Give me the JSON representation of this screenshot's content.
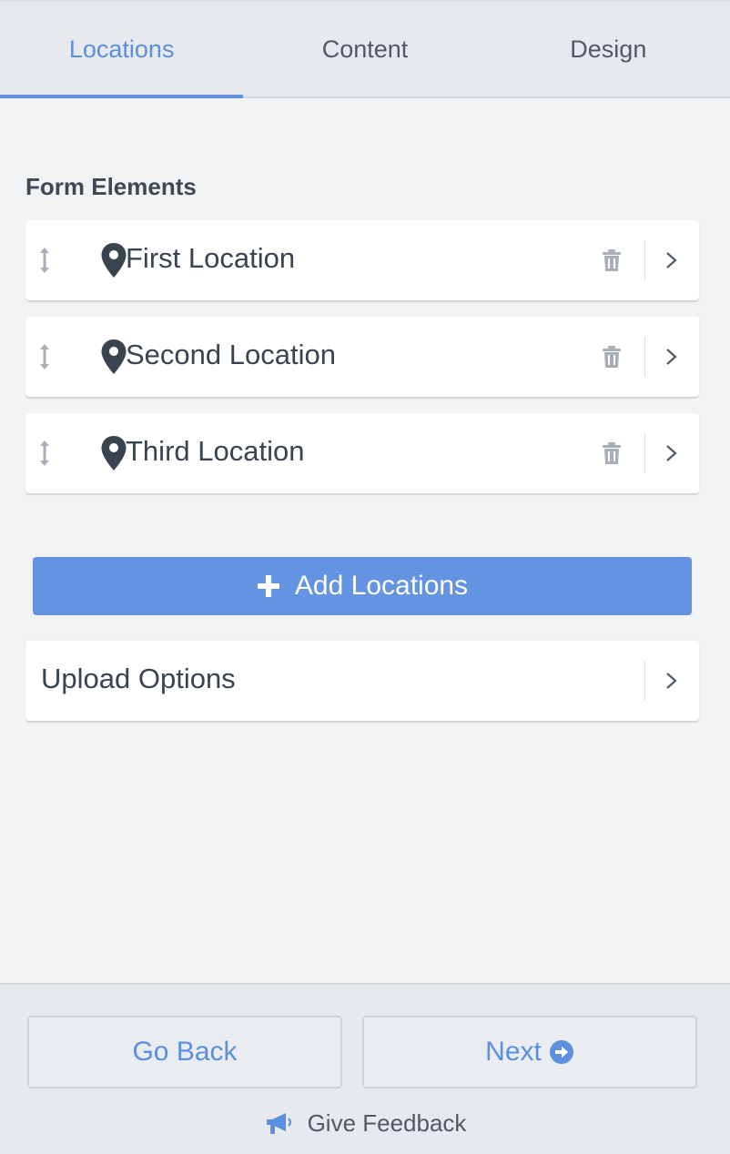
{
  "tabs": [
    {
      "label": "Locations",
      "active": true
    },
    {
      "label": "Content",
      "active": false
    },
    {
      "label": "Design",
      "active": false
    }
  ],
  "section_title": "Form Elements",
  "locations": [
    {
      "label": "First Location",
      "icon": "map-pin-icon"
    },
    {
      "label": "Second Location",
      "icon": "map-pin-icon"
    },
    {
      "label": "Third Location",
      "icon": "map-pin-icon"
    }
  ],
  "add_button": {
    "label": "Add Locations",
    "icon": "plus-icon"
  },
  "upload_options": {
    "label": "Upload Options"
  },
  "footer": {
    "back_label": "Go Back",
    "next_label": "Next",
    "next_icon": "arrow-circle-right-icon",
    "feedback_label": "Give Feedback",
    "feedback_icon": "megaphone-icon"
  },
  "colors": {
    "accent": "#6493e2",
    "tab_active": "#5b8fe0",
    "background": "#f2f3f5",
    "text": "#3a4350"
  }
}
